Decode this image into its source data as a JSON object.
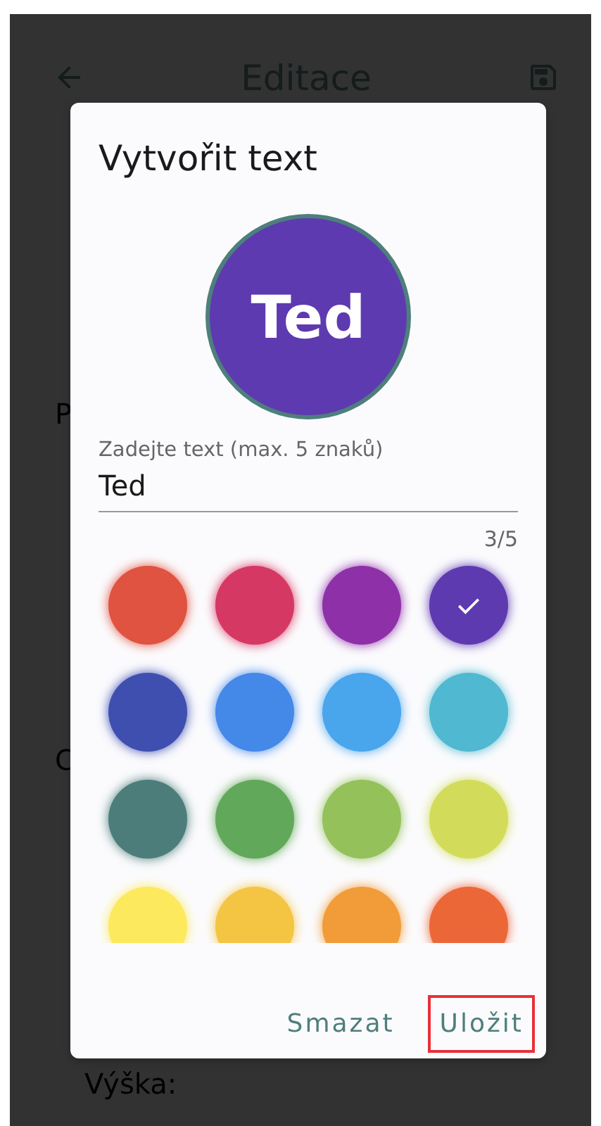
{
  "app_bar": {
    "title": "Editace"
  },
  "background_labels": [
    "P",
    "C",
    "Výška:"
  ],
  "dialog": {
    "title": "Vytvořit text",
    "avatar": {
      "text": "Ted",
      "color": "#5e3ab0"
    },
    "field": {
      "label": "Zadejte text (max. 5 znaků)",
      "value": "Ted",
      "counter": "3/5"
    },
    "swatches": [
      {
        "color": "#e05340",
        "selected": false
      },
      {
        "color": "#d63864",
        "selected": false
      },
      {
        "color": "#8e30a8",
        "selected": false
      },
      {
        "color": "#5e3ab0",
        "selected": true
      },
      {
        "color": "#3f4fb0",
        "selected": false
      },
      {
        "color": "#4488e8",
        "selected": false
      },
      {
        "color": "#49a5ec",
        "selected": false
      },
      {
        "color": "#50b8d0",
        "selected": false
      },
      {
        "color": "#4d7d7b",
        "selected": false
      },
      {
        "color": "#62a85a",
        "selected": false
      },
      {
        "color": "#94c15a",
        "selected": false
      },
      {
        "color": "#d2dc5a",
        "selected": false
      },
      {
        "color": "#fce95e",
        "selected": false
      },
      {
        "color": "#f4c443",
        "selected": false
      },
      {
        "color": "#f19c38",
        "selected": false
      },
      {
        "color": "#ec6738",
        "selected": false
      }
    ],
    "buttons": [
      {
        "label": "Smazat",
        "highlighted": false
      },
      {
        "label": "Uložit",
        "highlighted": true
      }
    ]
  }
}
